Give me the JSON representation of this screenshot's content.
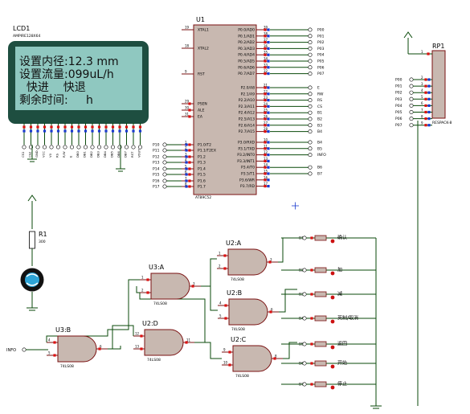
{
  "lcd": {
    "ref": "LCD1",
    "part": "AMPIRE128X64",
    "lines": [
      "设置内径:12.3 mm",
      "设置流量:099uL/h",
      "  快进    快退",
      "剩余时间:     h"
    ],
    "pin_labels": [
      "CS1",
      "CS2",
      "GND",
      "VCC",
      "V0",
      "RS",
      "R/W",
      "E",
      "DB0",
      "DB1",
      "DB2",
      "DB3",
      "DB4",
      "DB5",
      "DB6",
      "DB7",
      "RST",
      "VOUT"
    ]
  },
  "mcu": {
    "ref": "U1",
    "part": "AT89C52",
    "left_pins": [
      {
        "num": "19",
        "name": "XTAL1"
      },
      {
        "num": "18",
        "name": "XTAL2"
      },
      {
        "num": "9",
        "name": "RST"
      },
      {
        "num": "29",
        "name": "PSEN"
      },
      {
        "num": "30",
        "name": "ALE"
      },
      {
        "num": "31",
        "name": "EA"
      },
      {
        "num": "1",
        "name": "P1.0/T2"
      },
      {
        "num": "2",
        "name": "P1.1/T2EX"
      },
      {
        "num": "3",
        "name": "P1.2"
      },
      {
        "num": "4",
        "name": "P1.3"
      },
      {
        "num": "5",
        "name": "P1.4"
      },
      {
        "num": "6",
        "name": "P1.5"
      },
      {
        "num": "7",
        "name": "P1.6"
      },
      {
        "num": "8",
        "name": "P1.7"
      }
    ],
    "left_nets": [
      "P10",
      "P11",
      "P12",
      "P13",
      "P14",
      "P15",
      "P16",
      "P17"
    ],
    "right_pins_p0": [
      {
        "num": "39",
        "name": "P0.0/AD0",
        "net": "P00"
      },
      {
        "num": "38",
        "name": "P0.1/AD1",
        "net": "P01"
      },
      {
        "num": "37",
        "name": "P0.2/AD2",
        "net": "P02"
      },
      {
        "num": "36",
        "name": "P0.3/AD3",
        "net": "P03"
      },
      {
        "num": "35",
        "name": "P0.4/AD4",
        "net": "P04"
      },
      {
        "num": "34",
        "name": "P0.5/AD5",
        "net": "P05"
      },
      {
        "num": "33",
        "name": "P0.6/AD6",
        "net": "P06"
      },
      {
        "num": "32",
        "name": "P0.7/AD7",
        "net": "P07"
      }
    ],
    "right_pins_p2": [
      {
        "num": "21",
        "name": "P2.0/A8",
        "net": "E"
      },
      {
        "num": "22",
        "name": "P2.1/A9",
        "net": "RW"
      },
      {
        "num": "23",
        "name": "P2.2/A10",
        "net": "RS"
      },
      {
        "num": "24",
        "name": "P2.3/A11",
        "net": "CS"
      },
      {
        "num": "25",
        "name": "P2.4/A12",
        "net": "B1"
      },
      {
        "num": "26",
        "name": "P2.5/A13",
        "net": "B2"
      },
      {
        "num": "27",
        "name": "P2.6/A14",
        "net": "B3"
      },
      {
        "num": "28",
        "name": "P2.7/A15",
        "net": "B4"
      }
    ],
    "right_pins_p3": [
      {
        "num": "10",
        "name": "P3.0/RXD",
        "net": "B4"
      },
      {
        "num": "11",
        "name": "P3.1/TXD",
        "net": "B5"
      },
      {
        "num": "12",
        "name": "P3.2/INT0",
        "net": "INFO"
      },
      {
        "num": "13",
        "name": "P3.3/INT1",
        "net": ""
      },
      {
        "num": "14",
        "name": "P3.4/T0",
        "net": "B6"
      },
      {
        "num": "15",
        "name": "P3.5/T1",
        "net": "B7"
      },
      {
        "num": "16",
        "name": "P3.6/WR",
        "net": ""
      },
      {
        "num": "17",
        "name": "P3.7/RD",
        "net": ""
      }
    ]
  },
  "rp1": {
    "ref": "RP1",
    "part": "RESPACK-8",
    "nets": [
      "P00",
      "P01",
      "P02",
      "P03",
      "P04",
      "P05",
      "P06",
      "P07"
    ],
    "pin_nums": [
      "1",
      "2",
      "3",
      "4",
      "5",
      "6",
      "7",
      "8",
      "9"
    ]
  },
  "r1": {
    "ref": "R1",
    "value": "300"
  },
  "gates": [
    {
      "ref": "U2:A",
      "part": "74LS08",
      "in1": "1",
      "in2": "2",
      "out": "3"
    },
    {
      "ref": "U2:B",
      "part": "74LS08",
      "in1": "4",
      "in2": "5",
      "out": "6"
    },
    {
      "ref": "U2:C",
      "part": "74LS08",
      "in1": "9",
      "in2": "10",
      "out": "8"
    },
    {
      "ref": "U2:D",
      "part": "74LS08",
      "in1": "12",
      "in2": "13",
      "out": "11"
    },
    {
      "ref": "U3:A",
      "part": "74LS08",
      "in1": "1",
      "in2": "2",
      "out": "3"
    },
    {
      "ref": "U3:B",
      "part": "74LS08",
      "in1": "4",
      "in2": "5",
      "out": "6"
    }
  ],
  "buttons": [
    {
      "net": "B1",
      "label": "确认"
    },
    {
      "net": "B2",
      "label": "加"
    },
    {
      "net": "B3",
      "label": "减"
    },
    {
      "net": "B4",
      "label": "英制/取消"
    },
    {
      "net": "B5",
      "label": "返回"
    },
    {
      "net": "B6",
      "label": "开始"
    },
    {
      "net": "B7",
      "label": "停止"
    }
  ],
  "net_info": "INFO",
  "colors": {
    "wire": "#0a4a0a",
    "body": "#c8b8b0",
    "outline": "#7a1010",
    "lcd_bg": "#8fc8c0",
    "lcd_frame": "#1e4e40",
    "pin_red": "#dd1111",
    "pin_blue": "#1a3ad0"
  }
}
